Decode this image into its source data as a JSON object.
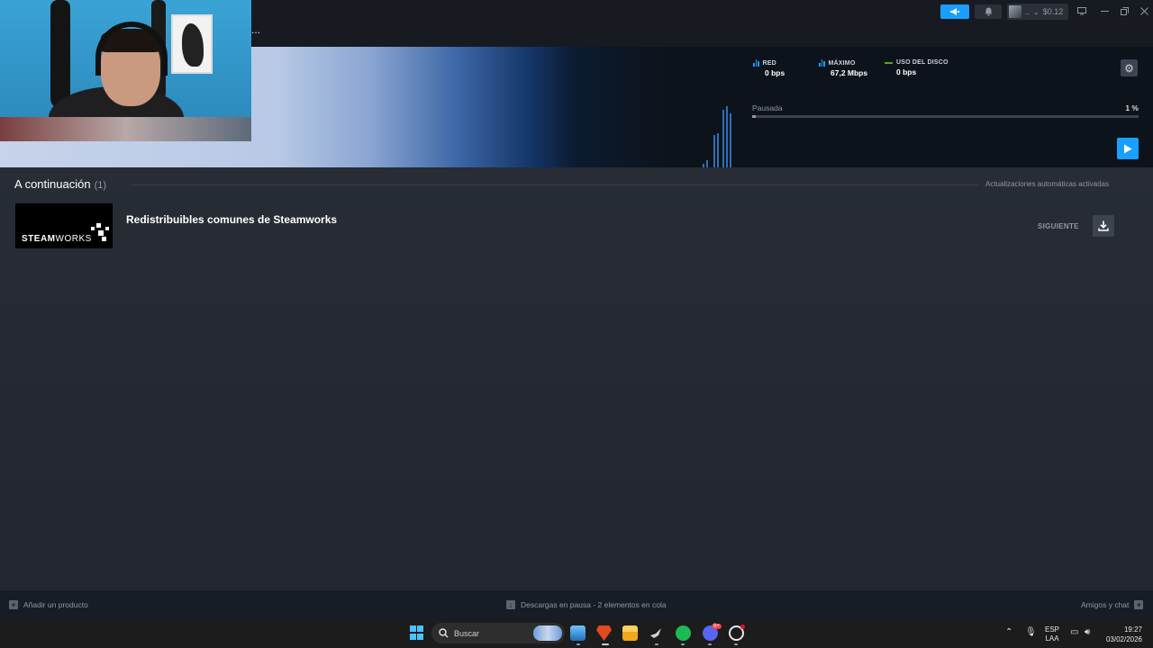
{
  "titlebar": {
    "account_name": "..",
    "account_chevron": "⌄",
    "balance": "$0.12",
    "announce_icon": "megaphone-icon",
    "bell_icon": "bell-icon",
    "dots": "..."
  },
  "stats": {
    "network": {
      "label": "RED",
      "value": "0 bps"
    },
    "peak": {
      "label": "MÁXIMO",
      "value": "67,2 Mbps"
    },
    "disk": {
      "label": "USO DEL DISCO",
      "value": "0 bps"
    },
    "status_label": "Pausada",
    "percent_label": "1 %",
    "percent_value": 0.01
  },
  "queue": {
    "title": "A continuación",
    "count": "(1)",
    "auto_updates": "Actualizaciones automáticas activadas",
    "items": [
      {
        "capsule_text_bold": "STEAM",
        "capsule_text_thin": "WORKS",
        "name": "Redistribuibles comunes de Steamworks",
        "status": "SIGUIENTE"
      }
    ]
  },
  "footer": {
    "add_product": "Añadir un producto",
    "download_status": "Descargas en pausa - 2 elementos en cola",
    "friends_chat": "Amigos y chat"
  },
  "taskbar": {
    "search_placeholder": "Buscar",
    "lang_line1": "ESP",
    "lang_line2": "LAA",
    "time": "19:27",
    "date": "03/02/2026",
    "discord_badge": "9+"
  },
  "colors": {
    "accent": "#1a9fff",
    "background": "#171d25",
    "disk_line": "#5ba32b"
  }
}
